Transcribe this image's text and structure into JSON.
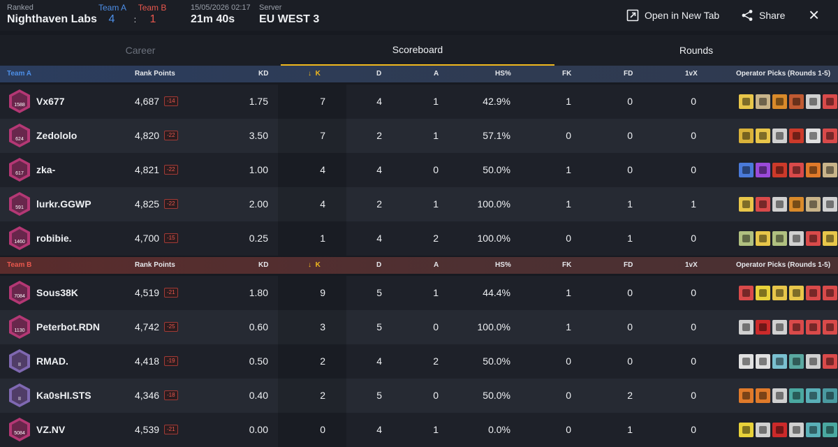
{
  "header": {
    "mode_label": "Ranked",
    "map": "Nighthaven Labs",
    "team_a_label": "Team A",
    "team_a_score": "4",
    "score_separator": ":",
    "team_b_label": "Team B",
    "team_b_score": "1",
    "datetime": "15/05/2026 02:17",
    "duration": "21m 40s",
    "server_label": "Server",
    "server": "EU WEST 3",
    "open_new_tab_label": "Open in New Tab",
    "share_label": "Share",
    "close_label": "×"
  },
  "tabs": [
    {
      "label": "Career",
      "active": false
    },
    {
      "label": "Scoreboard",
      "active": true
    },
    {
      "label": "Rounds",
      "active": false
    }
  ],
  "columns": {
    "rank_points": "Rank Points",
    "kd": "KD",
    "k": "K",
    "d": "D",
    "a": "A",
    "hs": "HS%",
    "fk": "FK",
    "fd": "FD",
    "onevx": "1vX",
    "ops": "Operator Picks (Rounds 1-5)"
  },
  "team_a": {
    "label": "Team A",
    "color": "#4d8fe8",
    "players": [
      {
        "badge": "1588",
        "badge_color": "#c43a7c",
        "name": "Vx677",
        "rp": "4,687",
        "delta": "-14",
        "kd": "1.75",
        "k": "7",
        "d": "4",
        "a": "1",
        "hs": "42.9%",
        "fk": "1",
        "fd": "0",
        "onevx": "0",
        "ops": [
          "#e8c64a",
          "#c9b48a",
          "#d98a2a",
          "#c05a32",
          "#d0d0d0",
          "#d94a4a"
        ]
      },
      {
        "badge": "624",
        "badge_color": "#c43a7c",
        "name": "Zedololo",
        "rp": "4,820",
        "delta": "-22",
        "kd": "3.50",
        "k": "7",
        "d": "2",
        "a": "1",
        "hs": "57.1%",
        "fk": "0",
        "fd": "0",
        "onevx": "0",
        "ops": [
          "#d9b23a",
          "#e8c64a",
          "#d0d0d0",
          "#cc3a2a",
          "#e0e0e0",
          "#d94a4a"
        ]
      },
      {
        "badge": "617",
        "badge_color": "#c43a7c",
        "name": "zka-",
        "rp": "4,821",
        "delta": "-22",
        "kd": "1.00",
        "k": "4",
        "d": "4",
        "a": "0",
        "hs": "50.0%",
        "fk": "1",
        "fd": "0",
        "onevx": "0",
        "ops": [
          "#4a7ad9",
          "#9a4ad9",
          "#cc3a2a",
          "#d94a4a",
          "#e07a2a",
          "#c9b48a"
        ]
      },
      {
        "badge": "591",
        "badge_color": "#c43a7c",
        "name": "lurkr.GGWP",
        "rp": "4,825",
        "delta": "-22",
        "kd": "2.00",
        "k": "4",
        "d": "2",
        "a": "1",
        "hs": "100.0%",
        "fk": "1",
        "fd": "1",
        "onevx": "1",
        "ops": [
          "#e8c64a",
          "#d94a4a",
          "#d0d0d0",
          "#d98a2a",
          "#c9b48a",
          "#d0d0d0"
        ]
      },
      {
        "badge": "1460",
        "badge_color": "#c43a7c",
        "name": "robibie.",
        "rp": "4,700",
        "delta": "-15",
        "kd": "0.25",
        "k": "1",
        "d": "4",
        "a": "2",
        "hs": "100.0%",
        "fk": "0",
        "fd": "1",
        "onevx": "0",
        "ops": [
          "#b0c080",
          "#e8c64a",
          "#b0c080",
          "#d0d0d0",
          "#d94a4a",
          "#e8c64a"
        ]
      }
    ]
  },
  "team_b": {
    "label": "Team B",
    "color": "#e8574d",
    "players": [
      {
        "badge": "7084",
        "badge_color": "#c43a7c",
        "name": "Sous38K",
        "rp": "4,519",
        "delta": "-21",
        "kd": "1.80",
        "k": "9",
        "d": "5",
        "a": "1",
        "hs": "44.4%",
        "fk": "1",
        "fd": "0",
        "onevx": "0",
        "ops": [
          "#d94a4a",
          "#e8d23a",
          "#e8c64a",
          "#e8c64a",
          "#d94a4a",
          "#d94a4a"
        ]
      },
      {
        "badge": "1130",
        "badge_color": "#c43a7c",
        "name": "Peterbot.RDN",
        "rp": "4,742",
        "delta": "-25",
        "kd": "0.60",
        "k": "3",
        "d": "5",
        "a": "0",
        "hs": "100.0%",
        "fk": "1",
        "fd": "0",
        "onevx": "0",
        "ops": [
          "#d0d0d0",
          "#cc2a2a",
          "#d0d0d0",
          "#d94a4a",
          "#d94a4a",
          "#d94a4a"
        ]
      },
      {
        "badge": "II",
        "badge_color": "#8a70c0",
        "name": "RMAD.",
        "rp": "4,418",
        "delta": "-19",
        "kd": "0.50",
        "k": "2",
        "d": "4",
        "a": "2",
        "hs": "50.0%",
        "fk": "0",
        "fd": "0",
        "onevx": "0",
        "ops": [
          "#e0e0e0",
          "#e0e0e0",
          "#7ac0d0",
          "#5aa8a0",
          "#d0d0d0",
          "#d94a4a"
        ]
      },
      {
        "badge": "II",
        "badge_color": "#8a70c0",
        "name": "Ka0sHI.STS",
        "rp": "4,346",
        "delta": "-18",
        "kd": "0.40",
        "k": "2",
        "d": "5",
        "a": "0",
        "hs": "50.0%",
        "fk": "0",
        "fd": "2",
        "onevx": "0",
        "ops": [
          "#e07a2a",
          "#e07a2a",
          "#d0d0d0",
          "#4aa8a0",
          "#5ab0b8",
          "#4a9aa0"
        ]
      },
      {
        "badge": "5084",
        "badge_color": "#c43a7c",
        "name": "VZ.NV",
        "rp": "4,539",
        "delta": "-21",
        "kd": "0.00",
        "k": "0",
        "d": "4",
        "a": "1",
        "hs": "0.0%",
        "fk": "0",
        "fd": "1",
        "onevx": "0",
        "ops": [
          "#e8d23a",
          "#d0d0d0",
          "#cc2a2a",
          "#d0d0d0",
          "#5ab0b8",
          "#4aa8a0"
        ]
      }
    ]
  }
}
